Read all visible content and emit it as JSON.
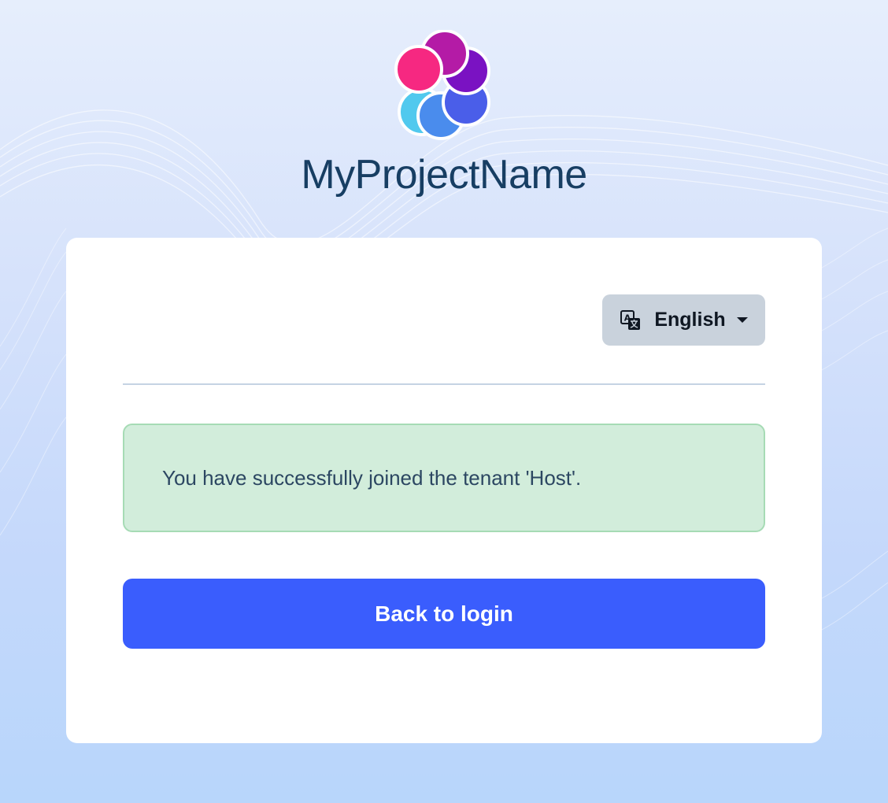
{
  "brand": {
    "name": "MyProjectName",
    "logo_icon": "flower-petals-logo"
  },
  "language": {
    "selected": "English",
    "icon": "translate-icon"
  },
  "alert": {
    "message": "You have successfully joined the tenant 'Host'.",
    "type": "success"
  },
  "actions": {
    "back_label": "Back to login"
  },
  "colors": {
    "brand_text": "#173e63",
    "primary_button": "#3a5dfd",
    "alert_bg": "#d2eddb",
    "alert_border": "#a6dbb5",
    "language_button_bg": "#c9d2dc"
  }
}
